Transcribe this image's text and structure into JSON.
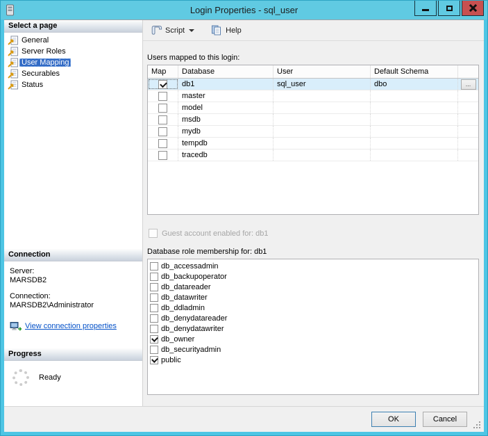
{
  "window": {
    "title": "Login Properties - sql_user",
    "icons": {
      "app": "server-icon",
      "minimize": "minimize-icon",
      "maximize": "maximize-icon",
      "close": "close-x-icon"
    }
  },
  "colors": {
    "titlebar": "#60cae2",
    "window_border": "#4ec5e4",
    "close_button": "#c75050",
    "selected_page_bg": "#316ac5",
    "selected_row_bg": "#d9eefb",
    "link": "#0451c8"
  },
  "sidebar": {
    "select_page_header": "Select a page",
    "pages": [
      {
        "label": "General",
        "selected": false
      },
      {
        "label": "Server Roles",
        "selected": false
      },
      {
        "label": "User Mapping",
        "selected": true
      },
      {
        "label": "Securables",
        "selected": false
      },
      {
        "label": "Status",
        "selected": false
      }
    ],
    "connection_header": "Connection",
    "server_label": "Server:",
    "server_value": "MARSDB2",
    "connection_label": "Connection:",
    "connection_value": "MARSDB2\\Administrator",
    "view_connection_link": "View connection properties",
    "progress_header": "Progress",
    "progress_status": "Ready"
  },
  "toolbar": {
    "script_label": "Script",
    "help_label": "Help",
    "icons": {
      "script": "scroll-icon",
      "script_caret": "chevron-down-icon",
      "help": "help-pages-icon"
    }
  },
  "main": {
    "users_mapped_label": "Users mapped to this login:",
    "table": {
      "columns": [
        "Map",
        "Database",
        "User",
        "Default Schema"
      ],
      "rows": [
        {
          "mapped": true,
          "database": "db1",
          "user": "sql_user",
          "default_schema": "dbo",
          "selected": true,
          "browse_button": "..."
        },
        {
          "mapped": false,
          "database": "master",
          "user": "",
          "default_schema": ""
        },
        {
          "mapped": false,
          "database": "model",
          "user": "",
          "default_schema": ""
        },
        {
          "mapped": false,
          "database": "msdb",
          "user": "",
          "default_schema": ""
        },
        {
          "mapped": false,
          "database": "mydb",
          "user": "",
          "default_schema": ""
        },
        {
          "mapped": false,
          "database": "tempdb",
          "user": "",
          "default_schema": ""
        },
        {
          "mapped": false,
          "database": "tracedb",
          "user": "",
          "default_schema": ""
        }
      ]
    },
    "guest_account_label": "Guest account enabled for: db1",
    "guest_account_checked": false,
    "role_membership_label": "Database role membership for: db1",
    "roles": [
      {
        "name": "db_accessadmin",
        "checked": false
      },
      {
        "name": "db_backupoperator",
        "checked": false
      },
      {
        "name": "db_datareader",
        "checked": false
      },
      {
        "name": "db_datawriter",
        "checked": false
      },
      {
        "name": "db_ddladmin",
        "checked": false
      },
      {
        "name": "db_denydatareader",
        "checked": false
      },
      {
        "name": "db_denydatawriter",
        "checked": false
      },
      {
        "name": "db_owner",
        "checked": true
      },
      {
        "name": "db_securityadmin",
        "checked": false
      },
      {
        "name": "public",
        "checked": true
      }
    ]
  },
  "footer": {
    "ok_label": "OK",
    "cancel_label": "Cancel"
  }
}
